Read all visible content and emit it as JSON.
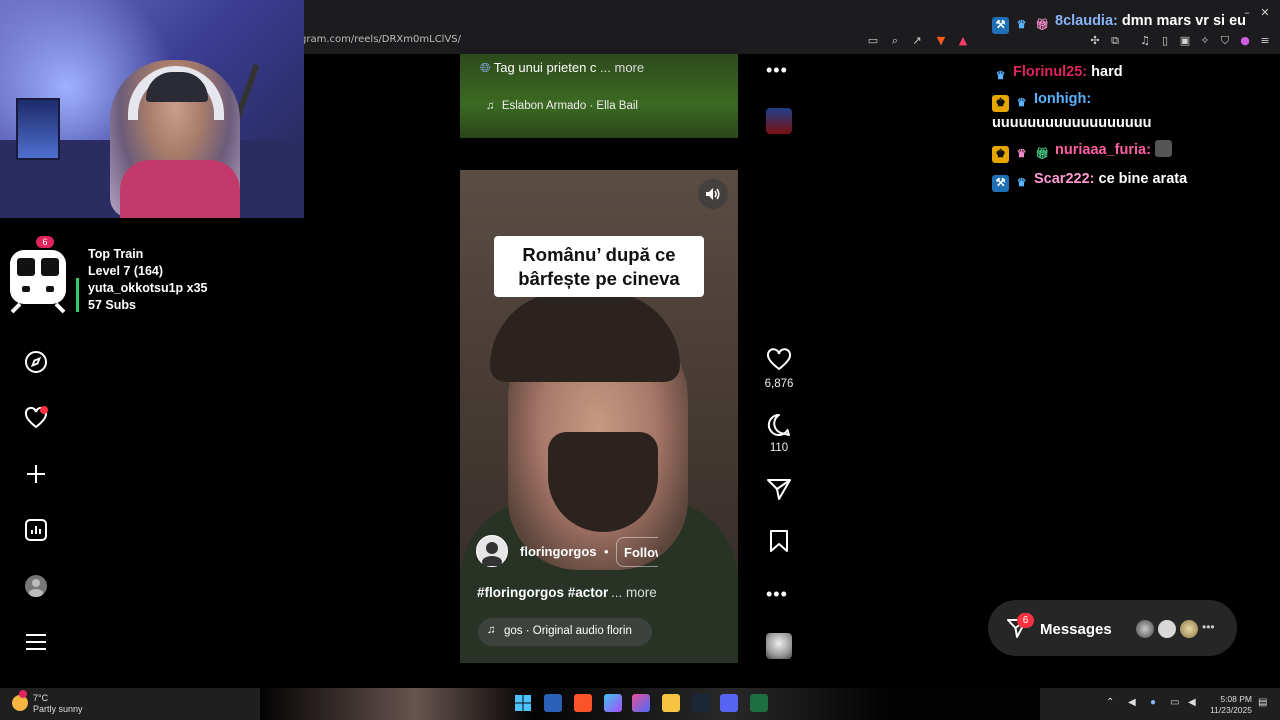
{
  "browser": {
    "url": "gram.com/reels/DRXm0mLClVS/"
  },
  "train": {
    "badge": "6",
    "title": "Top Train",
    "level": "Level 7  (164)",
    "user": "yuta_okkotsu1p x35",
    "subs": "57 Subs"
  },
  "reel_top": {
    "tag_text": "Tag unui prieten c",
    "more": "... more",
    "audio": "Eslabon Armado · Ella Bail"
  },
  "reel": {
    "caption": "Românu’ după ce bârfește pe cineva",
    "author": "floringorgos",
    "dot": "•",
    "follow": "Follow",
    "hashtags": "#floringorgos #actor",
    "more": "... more",
    "audio": "gos · Original audio  florin"
  },
  "actions": {
    "likes": "6,876",
    "comments": "110"
  },
  "chat": [
    {
      "user": "8claudia:",
      "message": "dmn mars vr si eu",
      "user_color": "#8ab4f8"
    },
    {
      "user": "Florinul25:",
      "message": "hard",
      "user_color": "#e0245e"
    },
    {
      "user": "Ionhigh:",
      "message": "uuuuuuuuuuuuuuuuuu",
      "user_color": "#5ab3ff"
    },
    {
      "user": "nuriaaa_furia:",
      "message": "",
      "user_color": "#ff5fa2"
    },
    {
      "user": "Scar222:",
      "message": "ce bine arata",
      "user_color": "#ff9ad5"
    }
  ],
  "messages": {
    "label": "Messages",
    "badge": "6"
  },
  "taskbar": {
    "weather_temp": "7°C",
    "weather_desc": "Partly sunny",
    "time": "5:08 PM",
    "date": "11/23/2025"
  },
  "colors": {
    "like_red": "#ff3040",
    "train_green": "#33cc66"
  }
}
